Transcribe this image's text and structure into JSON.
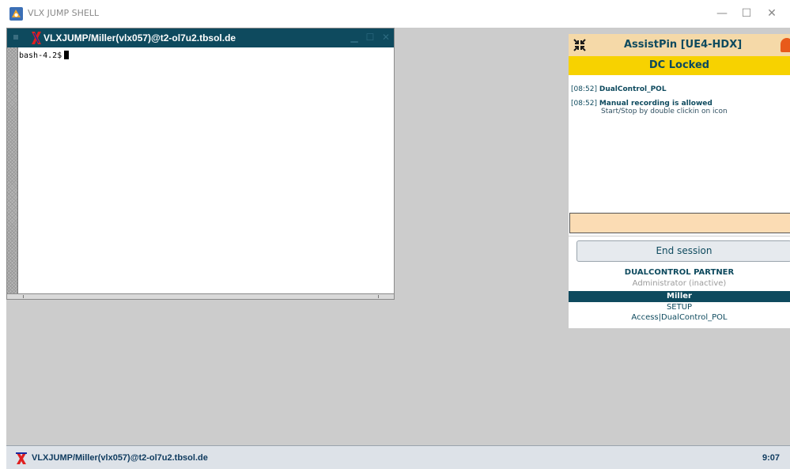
{
  "window": {
    "title": "VLX JUMP SHELL",
    "controls": {
      "minimize": "—",
      "maximize": "☐",
      "close": "✕"
    }
  },
  "terminal": {
    "title": "VLXJUMP/Miller(vlx057)@t2-ol7u2.tbsol.de",
    "prompt": "bash-4.2$",
    "controls": {
      "minimize": "▁",
      "maximize": "☐",
      "close": "✕"
    }
  },
  "assist_panel": {
    "title": "AssistPin [UE4-HDX]",
    "status": "DC Locked",
    "status_color": "#f7d200",
    "log": [
      {
        "time": "[08:52]",
        "message": "DualControl_POL",
        "detail": ""
      },
      {
        "time": "[08:52]",
        "message": "Manual recording is allowed",
        "detail": "Start/Stop by double clickin on icon"
      }
    ],
    "input_value": "",
    "end_session_label": "End session",
    "partner_heading": "DUALCONTROL PARTNER",
    "partner_role": "Administrator (inactive)",
    "user_name": "Miller",
    "user_role": "SETUP",
    "user_access": "Access|DualControl_POL"
  },
  "taskbar": {
    "title": "VLXJUMP/Miller(vlx057)@t2-ol7u2.tbsol.de",
    "clock": "9:07"
  },
  "icons": {
    "app": "vlx-app-icon",
    "terminal_logo": "x-logo-icon",
    "collapse": "collapse-arrows-icon",
    "badge": "record-badge-icon"
  }
}
